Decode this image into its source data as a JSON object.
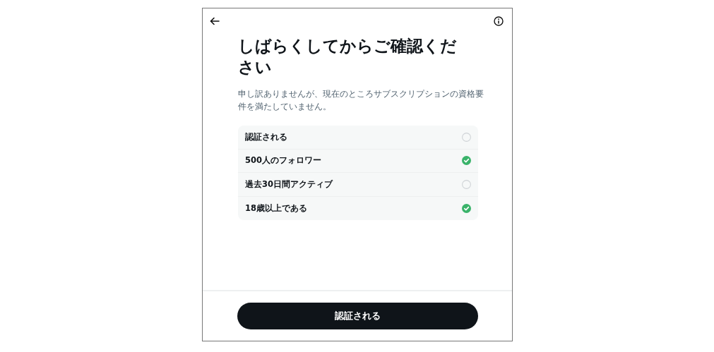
{
  "title": "しばらくしてからご確認ください",
  "message": "申し訳ありませんが、現在のところサブスクリプションの資格要件を満たしていません。",
  "requirements": [
    {
      "label": "認証される",
      "checked": false
    },
    {
      "label": "500人のフォロワー",
      "checked": true
    },
    {
      "label": "過去30日間アクティブ",
      "checked": false
    },
    {
      "label": "18歳以上である",
      "checked": true
    }
  ],
  "button": "認証される"
}
